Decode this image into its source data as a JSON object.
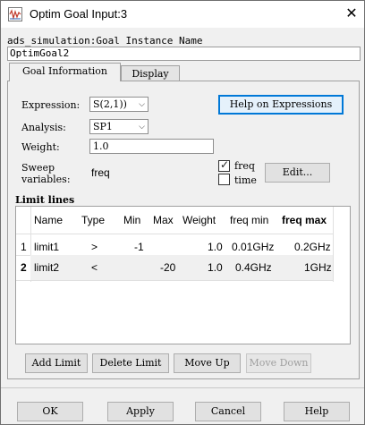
{
  "window": {
    "title": "Optim Goal Input:3"
  },
  "instance": {
    "label": "ads_simulation:Goal Instance Name",
    "value": "OptimGoal2"
  },
  "tabs": [
    {
      "label": "Goal Information"
    },
    {
      "label": "Display"
    }
  ],
  "goal": {
    "expression_label": "Expression:",
    "expression_value": "S(2,1))",
    "analysis_label": "Analysis:",
    "analysis_value": "SP1",
    "weight_label": "Weight:",
    "weight_value": "1.0",
    "sweep_label_line1": "Sweep",
    "sweep_label_line2": "variables:",
    "sweep_value": "freq",
    "help_button": "Help on Expressions",
    "edit_button": "Edit...",
    "checkboxes": [
      {
        "label": "freq",
        "checked": true
      },
      {
        "label": "time",
        "checked": false
      }
    ]
  },
  "limits": {
    "section_label": "Limit lines",
    "columns": [
      "Name",
      "Type",
      "Min",
      "Max",
      "Weight",
      "freq min",
      "freq max"
    ],
    "rows": [
      {
        "index": "1",
        "name": "limit1",
        "type": ">",
        "min": "-1",
        "max": "",
        "weight": "1.0",
        "freq_min": "0.01GHz",
        "freq_max": "0.2GHz"
      },
      {
        "index": "2",
        "name": "limit2",
        "type": "<",
        "min": "",
        "max": "-20",
        "weight": "1.0",
        "freq_min": "0.4GHz",
        "freq_max": "1GHz"
      }
    ],
    "buttons": {
      "add": "Add Limit",
      "delete": "Delete Limit",
      "move_up": "Move Up",
      "move_down": "Move Down"
    }
  },
  "footer": {
    "ok": "OK",
    "apply": "Apply",
    "cancel": "Cancel",
    "help": "Help"
  },
  "icons": {
    "app": "waveform-icon",
    "close": "close-icon",
    "dropdown": "chevron-down-icon",
    "check": "checkmark-icon"
  },
  "colors": {
    "accent": "#0078d7",
    "window_bg": "#f0f0f0"
  }
}
